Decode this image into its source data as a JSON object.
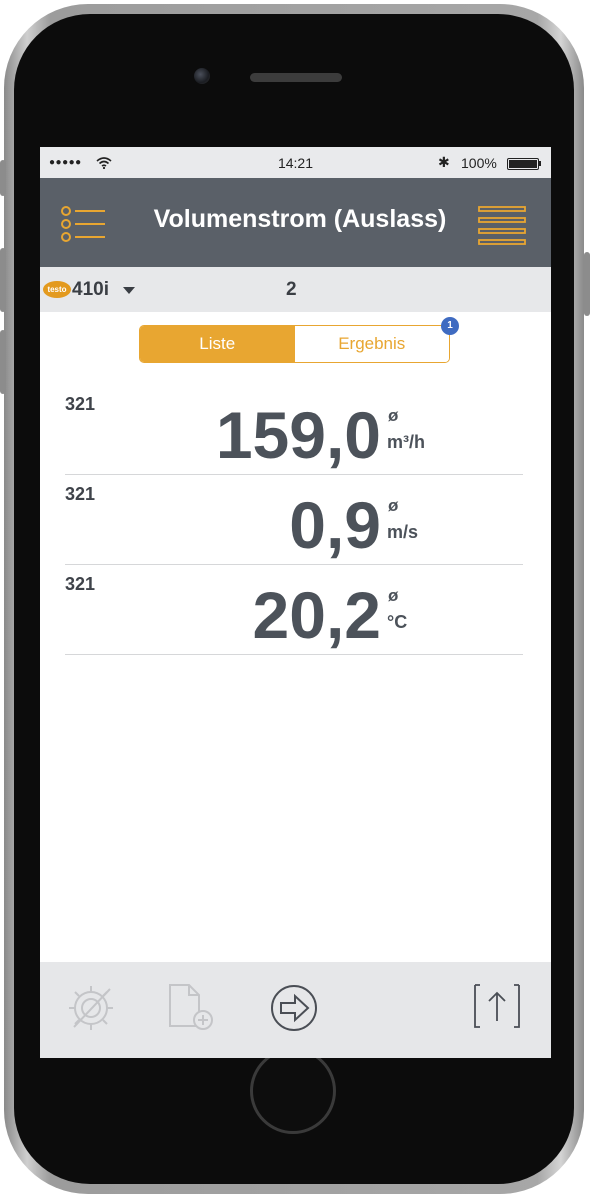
{
  "status_bar": {
    "signal": "●●●●● ",
    "time": "14:21",
    "bluetooth": "✱",
    "battery": "100%"
  },
  "app_bar": {
    "title": "Volumenstrom (Auslass)",
    "left_icon": "list-menu-icon",
    "right_icon": "hamburger-icon"
  },
  "device_bar": {
    "logo": "testo",
    "device": "410i",
    "count": "2"
  },
  "segments": {
    "liste": "Liste",
    "ergebnis": "Ergebnis",
    "badge": "1"
  },
  "readings": [
    {
      "label": "321",
      "value": "159,0",
      "avg": "ø",
      "unit": "m³/h"
    },
    {
      "label": "321",
      "value": "0,9",
      "avg": "ø",
      "unit": "m/s"
    },
    {
      "label": "321",
      "value": "20,2",
      "avg": "ø",
      "unit": "°C"
    }
  ],
  "toolbar": {
    "icons": [
      "settings-icon",
      "new-file-icon",
      "next-arrow-icon",
      "export-icon"
    ]
  },
  "colors": {
    "accent": "#e8a631",
    "appbar": "#5a6068",
    "badge": "#3f6bc1"
  }
}
